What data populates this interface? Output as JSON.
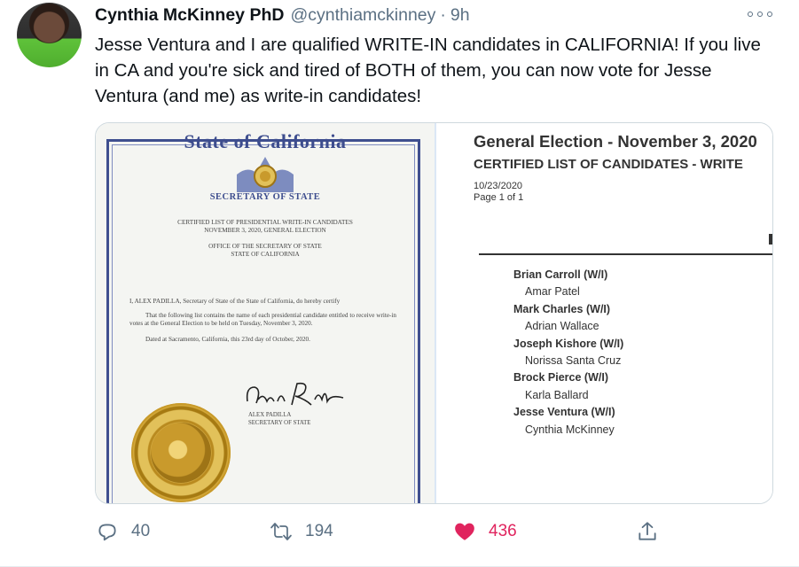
{
  "tweet": {
    "author_name": "Cynthia McKinney PhD",
    "author_handle": "@cynthiamckinney",
    "separator": "·",
    "time": "9h",
    "text": "Jesse Ventura and I are qualified WRITE-IN candidates in CALIFORNIA! If you live in CA and you're sick and tired of BOTH of them, you can now vote for Jesse Ventura (and me) as write-in candidates!"
  },
  "certificate": {
    "title": "State of California",
    "office": "SECRETARY OF STATE",
    "heading_line1": "CERTIFIED LIST OF PRESIDENTIAL WRITE-IN CANDIDATES",
    "heading_line2": "NOVEMBER 3, 2020, GENERAL ELECTION",
    "office_line1": "OFFICE OF THE SECRETARY OF STATE",
    "office_line2": "STATE OF CALIFORNIA",
    "certify": "I, ALEX PADILLA, Secretary of State of the State of California, do hereby certify",
    "body": "That the following list contains the name of each presidential candidate entitled to receive write-in votes at the General Election to be held on Tuesday, November 3, 2020.",
    "dated": "Dated at Sacramento, California, this 23rd day of October, 2020.",
    "signer_name": "ALEX PADILLA",
    "signer_title": "SECRETARY OF STATE"
  },
  "document": {
    "title": "General Election - November 3, 2020",
    "subtitle": "CERTIFIED LIST OF CANDIDATES - WRITE",
    "date": "10/23/2020",
    "page": "Page 1 of 1",
    "candidates": [
      {
        "president": "Brian Carroll (W/I)",
        "vp": "Amar Patel"
      },
      {
        "president": "Mark Charles (W/I)",
        "vp": "Adrian Wallace"
      },
      {
        "president": "Joseph Kishore (W/I)",
        "vp": "Norissa Santa Cruz"
      },
      {
        "president": "Brock Pierce (W/I)",
        "vp": "Karla Ballard"
      },
      {
        "president": "Jesse Ventura (W/I)",
        "vp": "Cynthia McKinney"
      }
    ]
  },
  "actions": {
    "reply_count": "40",
    "retweet_count": "194",
    "like_count": "436",
    "like_color": "#e0245e",
    "icon_color": "#5b7083"
  }
}
